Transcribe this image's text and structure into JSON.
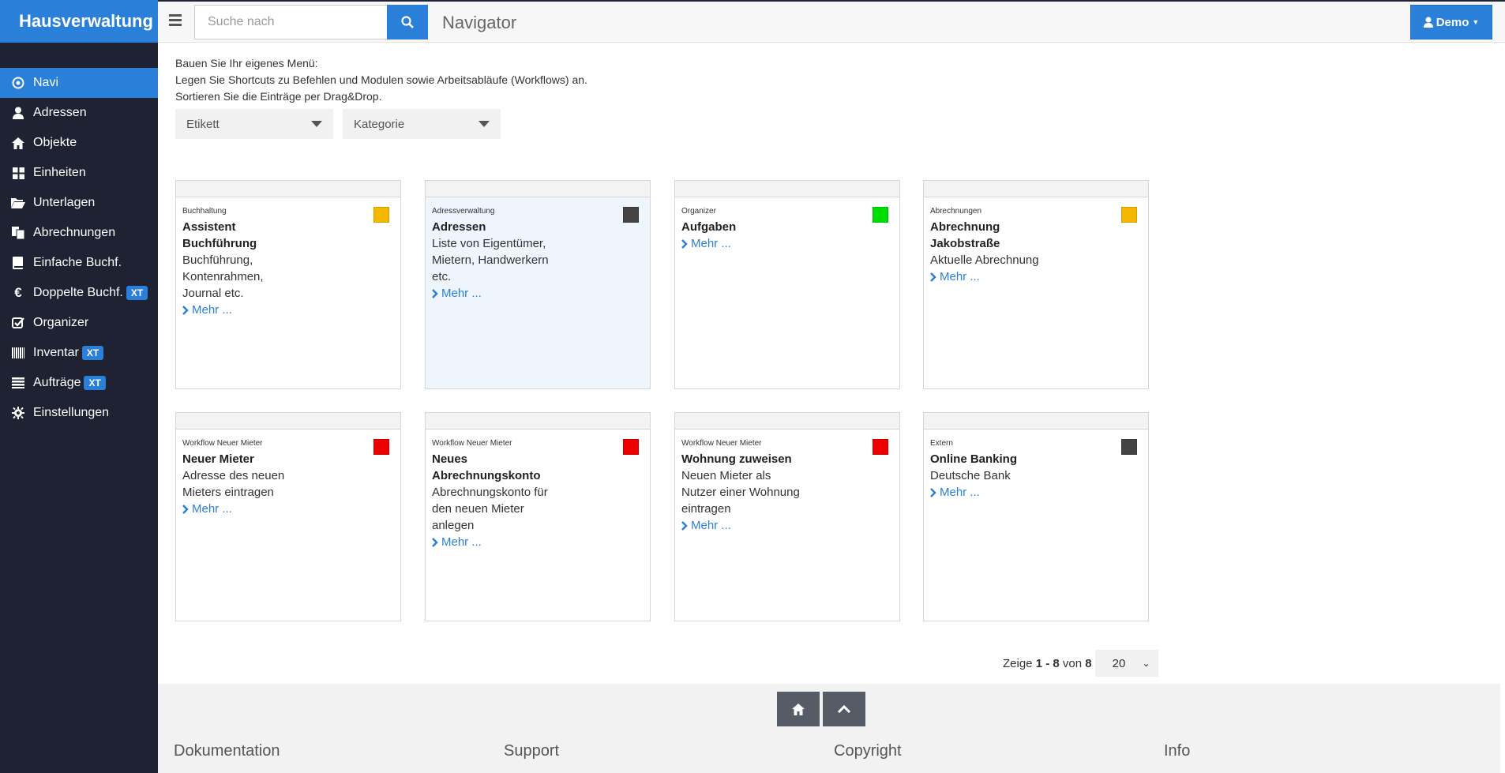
{
  "app": {
    "title": "Hausverwaltung"
  },
  "header": {
    "search_placeholder": "Suche nach",
    "page_heading": "Navigator",
    "user_label": "Demo"
  },
  "sidebar": {
    "items": [
      {
        "label": "Navi",
        "icon": "target-icon",
        "active": true
      },
      {
        "label": "Adressen",
        "icon": "user-icon"
      },
      {
        "label": "Objekte",
        "icon": "home-icon"
      },
      {
        "label": "Einheiten",
        "icon": "grid-icon"
      },
      {
        "label": "Unterlagen",
        "icon": "folder-open-icon"
      },
      {
        "label": "Abrechnungen",
        "icon": "documents-icon"
      },
      {
        "label": "Einfache Buchf.",
        "icon": "book-icon"
      },
      {
        "label": "Doppelte Buchf.",
        "icon": "euro-icon",
        "badge": "XT"
      },
      {
        "label": "Organizer",
        "icon": "checkbox-icon"
      },
      {
        "label": "Inventar",
        "icon": "barcode-icon",
        "badge": "XT"
      },
      {
        "label": "Aufträge",
        "icon": "list-icon",
        "badge": "XT"
      },
      {
        "label": "Einstellungen",
        "icon": "gear-icon"
      }
    ]
  },
  "intro": {
    "line1": "Bauen Sie Ihr eigenes Menü:",
    "line2": "Legen Sie Shortcuts zu Befehlen und Modulen sowie Arbeitsabläufe (Workflows) an.",
    "line3": "Sortieren Sie die Einträge per Drag&Drop."
  },
  "filters": {
    "etikett": "Etikett",
    "kategorie": "Kategorie"
  },
  "cards": [
    {
      "category": "Buchhaltung",
      "title": "Assistent Buchführung",
      "desc": "Buchführung, Kontenrahmen, Journal etc.",
      "more": "Mehr ...",
      "color": "#f5b800"
    },
    {
      "category": "Adressverwaltung",
      "title": "Adressen",
      "desc": "Liste von Eigentümer, Mietern, Handwerkern etc.",
      "more": "Mehr ...",
      "color": "#444444"
    },
    {
      "category": "Organizer",
      "title": "Aufgaben",
      "desc": "",
      "more": "Mehr ...",
      "color": "#00dd00"
    },
    {
      "category": "Abrechnungen",
      "title": "Abrechnung Jakobstraße",
      "desc": "Aktuelle Abrechnung",
      "more": "Mehr ...",
      "color": "#f5b800"
    },
    {
      "category": "Workflow Neuer Mieter",
      "title": "Neuer Mieter",
      "desc": "Adresse des neuen Mieters eintragen",
      "more": "Mehr ...",
      "color": "#ee0000"
    },
    {
      "category": "Workflow Neuer Mieter",
      "title": "Neues Abrechnungskonto",
      "desc": "Abrechnungskonto für den neuen Mieter anlegen",
      "more": "Mehr ...",
      "color": "#ee0000"
    },
    {
      "category": "Workflow Neuer Mieter",
      "title": "Wohnung zuweisen",
      "desc": "Neuen Mieter als Nutzer einer Wohnung eintragen",
      "more": "Mehr ...",
      "color": "#ee0000"
    },
    {
      "category": "Extern",
      "title": "Online Banking",
      "desc": "Deutsche Bank",
      "more": "Mehr ...",
      "color": "#444444"
    }
  ],
  "pager": {
    "prefix": "Zeige",
    "from": "1",
    "dash": "-",
    "to": "8",
    "of": "von",
    "total": "8",
    "page_size": "20"
  },
  "footer": {
    "cols": [
      "Dokumentation",
      "Support",
      "Copyright",
      "Info"
    ]
  }
}
